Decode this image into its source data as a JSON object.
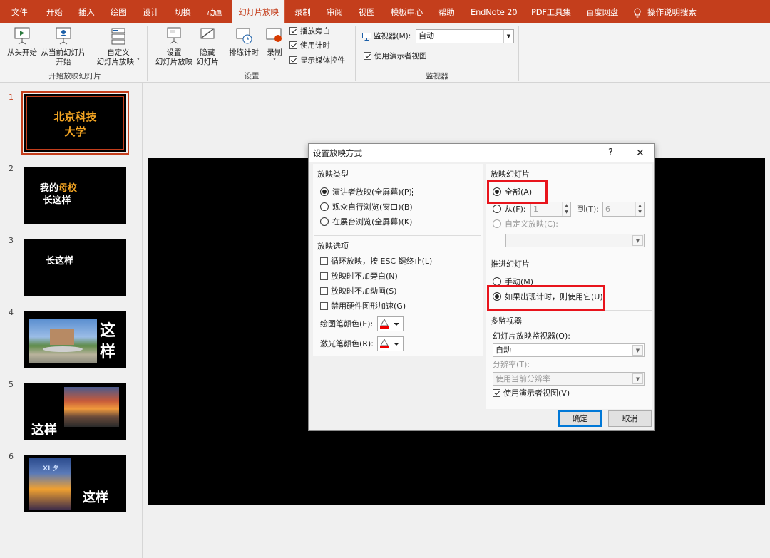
{
  "ribbon_tabs": [
    "文件",
    "开始",
    "插入",
    "绘图",
    "设计",
    "切换",
    "动画",
    "幻灯片放映",
    "录制",
    "审阅",
    "视图",
    "模板中心",
    "帮助",
    "EndNote 20",
    "PDF工具集",
    "百度网盘"
  ],
  "active_tab": "幻灯片放映",
  "search_label": "操作说明搜索",
  "ribbon": {
    "from_beginning": "从头开始",
    "from_current_1": "从当前幻灯片",
    "from_current_2": "开始",
    "custom_1": "自定义",
    "custom_2": "幻灯片放映",
    "group_start": "开始放映幻灯片",
    "setup_1": "设置",
    "setup_2": "幻灯片放映",
    "hide_1": "隐藏",
    "hide_2": "幻灯片",
    "rehearse": "排练计时",
    "record": "录制",
    "play_narration": "播放旁白",
    "use_timings": "使用计时",
    "show_media": "显示媒体控件",
    "group_setup": "设置",
    "monitor_label": "监视器(M):",
    "monitor_value": "自动",
    "presenter_view": "使用演示者视图",
    "group_monitors": "监视器"
  },
  "slides": [
    {
      "num": "1",
      "line1": "北京科技",
      "line2": "大学"
    },
    {
      "num": "2",
      "a": "我的",
      "b": "母校",
      "line2": "长这样"
    },
    {
      "num": "3",
      "text": "长这样"
    },
    {
      "num": "4",
      "line1": "这",
      "line2": "样"
    },
    {
      "num": "5",
      "text": "这样"
    },
    {
      "num": "6",
      "text": "这样",
      "photo_text": "XI 夕"
    }
  ],
  "dialog": {
    "title": "设置放映方式",
    "help": "?",
    "close": "✕",
    "show_type_title": "放映类型",
    "show_types": [
      "演讲者放映(全屏幕)(P)",
      "观众自行浏览(窗口)(B)",
      "在展台浏览(全屏幕)(K)"
    ],
    "show_options_title": "放映选项",
    "show_options": [
      "循环放映，按 ESC 键终止(L)",
      "放映时不加旁白(N)",
      "放映时不加动画(S)",
      "禁用硬件图形加速(G)"
    ],
    "pen_color_label": "绘图笔颜色(E):",
    "laser_color_label": "激光笔颜色(R):",
    "show_slides_title": "放映幻灯片",
    "all_label": "全部(A)",
    "from_label": "从(F):",
    "from_value": "1",
    "to_label": "到(T):",
    "to_value": "6",
    "custom_show_label": "自定义放映(C):",
    "advance_title": "推进幻灯片",
    "manual_label": "手动(M)",
    "timings_label": "如果出现计时，则使用它(U)",
    "multi_monitor_title": "多监视器",
    "monitor_label": "幻灯片放映监视器(O):",
    "monitor_value": "自动",
    "resolution_label": "分辨率(T):",
    "resolution_value": "使用当前分辨率",
    "presenter_view_label": "使用演示者视图(V)",
    "ok": "确定",
    "cancel": "取消"
  },
  "colors": {
    "accent": "#c43e1c",
    "highlight": "#e8141c",
    "slide_title": "#f5a623"
  }
}
